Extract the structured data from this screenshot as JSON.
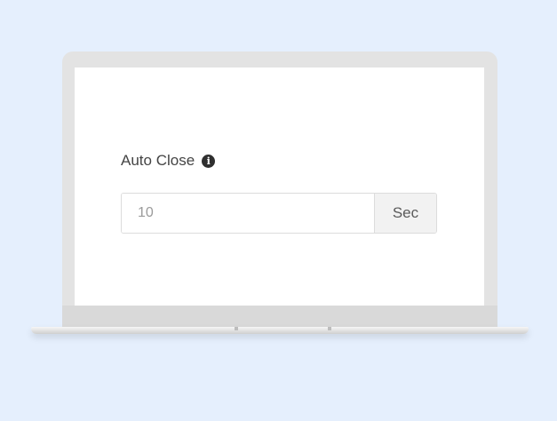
{
  "setting": {
    "label": "Auto Close",
    "info_icon": "info-icon",
    "info_glyph": "i",
    "input_value": "",
    "input_placeholder": "10",
    "unit": "Sec"
  },
  "colors": {
    "page_background": "#e5effd",
    "laptop_frame": "#e3e3e3",
    "screen": "#ffffff",
    "addon_background": "#f2f2f2"
  }
}
